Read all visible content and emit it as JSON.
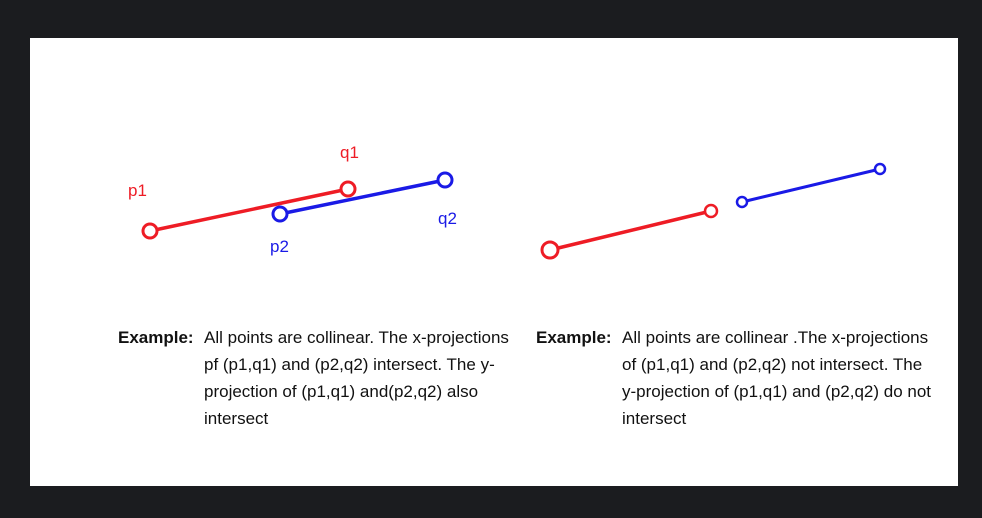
{
  "colors": {
    "segment_pq1": "#ee1c25",
    "segment_pq2": "#1a1ae6",
    "frame": "#1b1c1f",
    "canvas": "#ffffff"
  },
  "left_figure": {
    "labels": {
      "p1": "p1",
      "q1": "q1",
      "p2": "p2",
      "q2": "q2"
    },
    "caption_label": "Example:",
    "caption_text": "All points are collinear. The x-projections pf (p1,q1) and (p2,q2) intersect. The y-projection of (p1,q1) and(p2,q2) also intersect"
  },
  "right_figure": {
    "caption_label": "Example:",
    "caption_text": "All points are collinear .The x-projections of (p1,q1) and (p2,q2) not intersect. The y-projection of (p1,q1)  and (p2,q2) do not intersect"
  }
}
